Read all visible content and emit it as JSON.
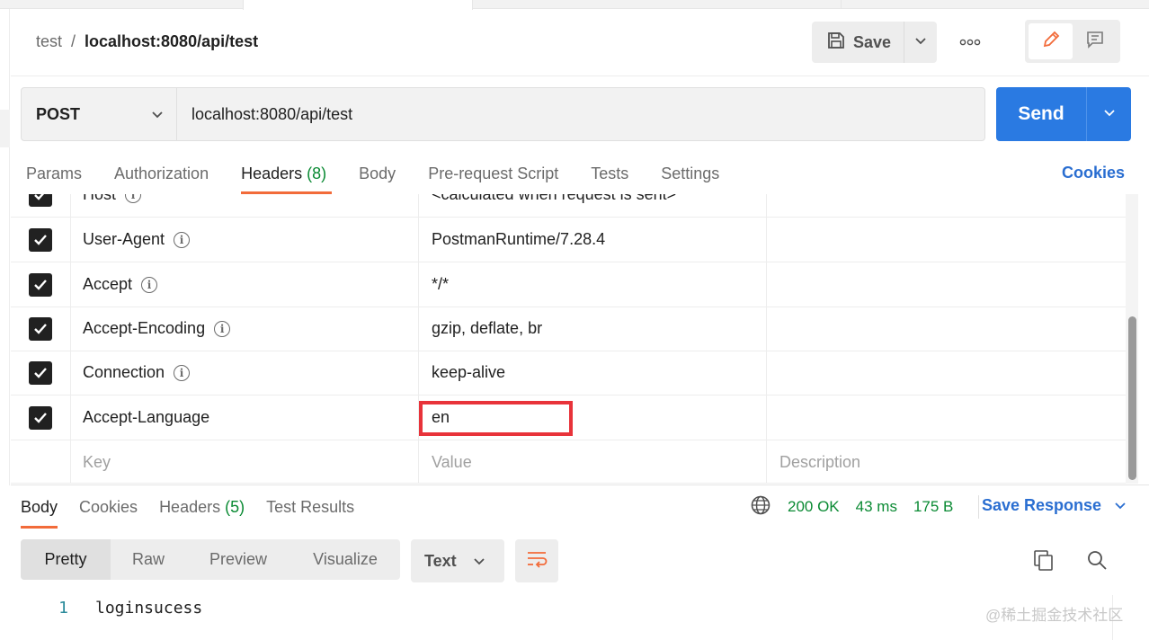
{
  "breadcrumb": {
    "collection": "test",
    "separator": "/",
    "request_name": "localhost:8080/api/test"
  },
  "toolbar": {
    "save_label": "Save",
    "more_icon": "ellipsis-icon",
    "edit_icon": "pencil-icon",
    "comments_icon": "comment-icon"
  },
  "request": {
    "method": "POST",
    "url": "localhost:8080/api/test",
    "send_label": "Send"
  },
  "request_tabs": [
    {
      "label": "Params",
      "count": ""
    },
    {
      "label": "Authorization",
      "count": ""
    },
    {
      "label": "Headers",
      "count": "(8)"
    },
    {
      "label": "Body",
      "count": ""
    },
    {
      "label": "Pre-request Script",
      "count": ""
    },
    {
      "label": "Tests",
      "count": ""
    },
    {
      "label": "Settings",
      "count": ""
    }
  ],
  "active_request_tab": "Headers",
  "cookies_link": "Cookies",
  "headers": {
    "rows": [
      {
        "key": "Host",
        "value": "<calculated when request is sent>",
        "checked": true,
        "info": true
      },
      {
        "key": "User-Agent",
        "value": "PostmanRuntime/7.28.4",
        "checked": true,
        "info": true
      },
      {
        "key": "Accept",
        "value": "*/*",
        "checked": true,
        "info": true
      },
      {
        "key": "Accept-Encoding",
        "value": "gzip, deflate, br",
        "checked": true,
        "info": true
      },
      {
        "key": "Connection",
        "value": "keep-alive",
        "checked": true,
        "info": true
      },
      {
        "key": "Accept-Language",
        "value": "en",
        "checked": true,
        "info": false
      }
    ],
    "placeholders": {
      "key": "Key",
      "value": "Value",
      "description": "Description"
    }
  },
  "response": {
    "tabs": [
      {
        "label": "Body",
        "count": ""
      },
      {
        "label": "Cookies",
        "count": ""
      },
      {
        "label": "Headers",
        "count": "(5)"
      },
      {
        "label": "Test Results",
        "count": ""
      }
    ],
    "active_tab": "Body",
    "status": "200 OK",
    "time": "43 ms",
    "size": "175 B",
    "save_response_label": "Save Response",
    "format_tabs": [
      "Pretty",
      "Raw",
      "Preview",
      "Visualize"
    ],
    "active_format": "Pretty",
    "type_select": "Text",
    "body_lines": [
      {
        "num": "1",
        "text": "loginsucess"
      }
    ]
  },
  "watermark": "@稀土掘金技术社区",
  "colors": {
    "accent": "#f26b3a",
    "send_blue": "#2a7ae2",
    "link_blue": "#2a6ed1",
    "status_green": "#0a8a33",
    "highlight_red": "#e8333a"
  }
}
